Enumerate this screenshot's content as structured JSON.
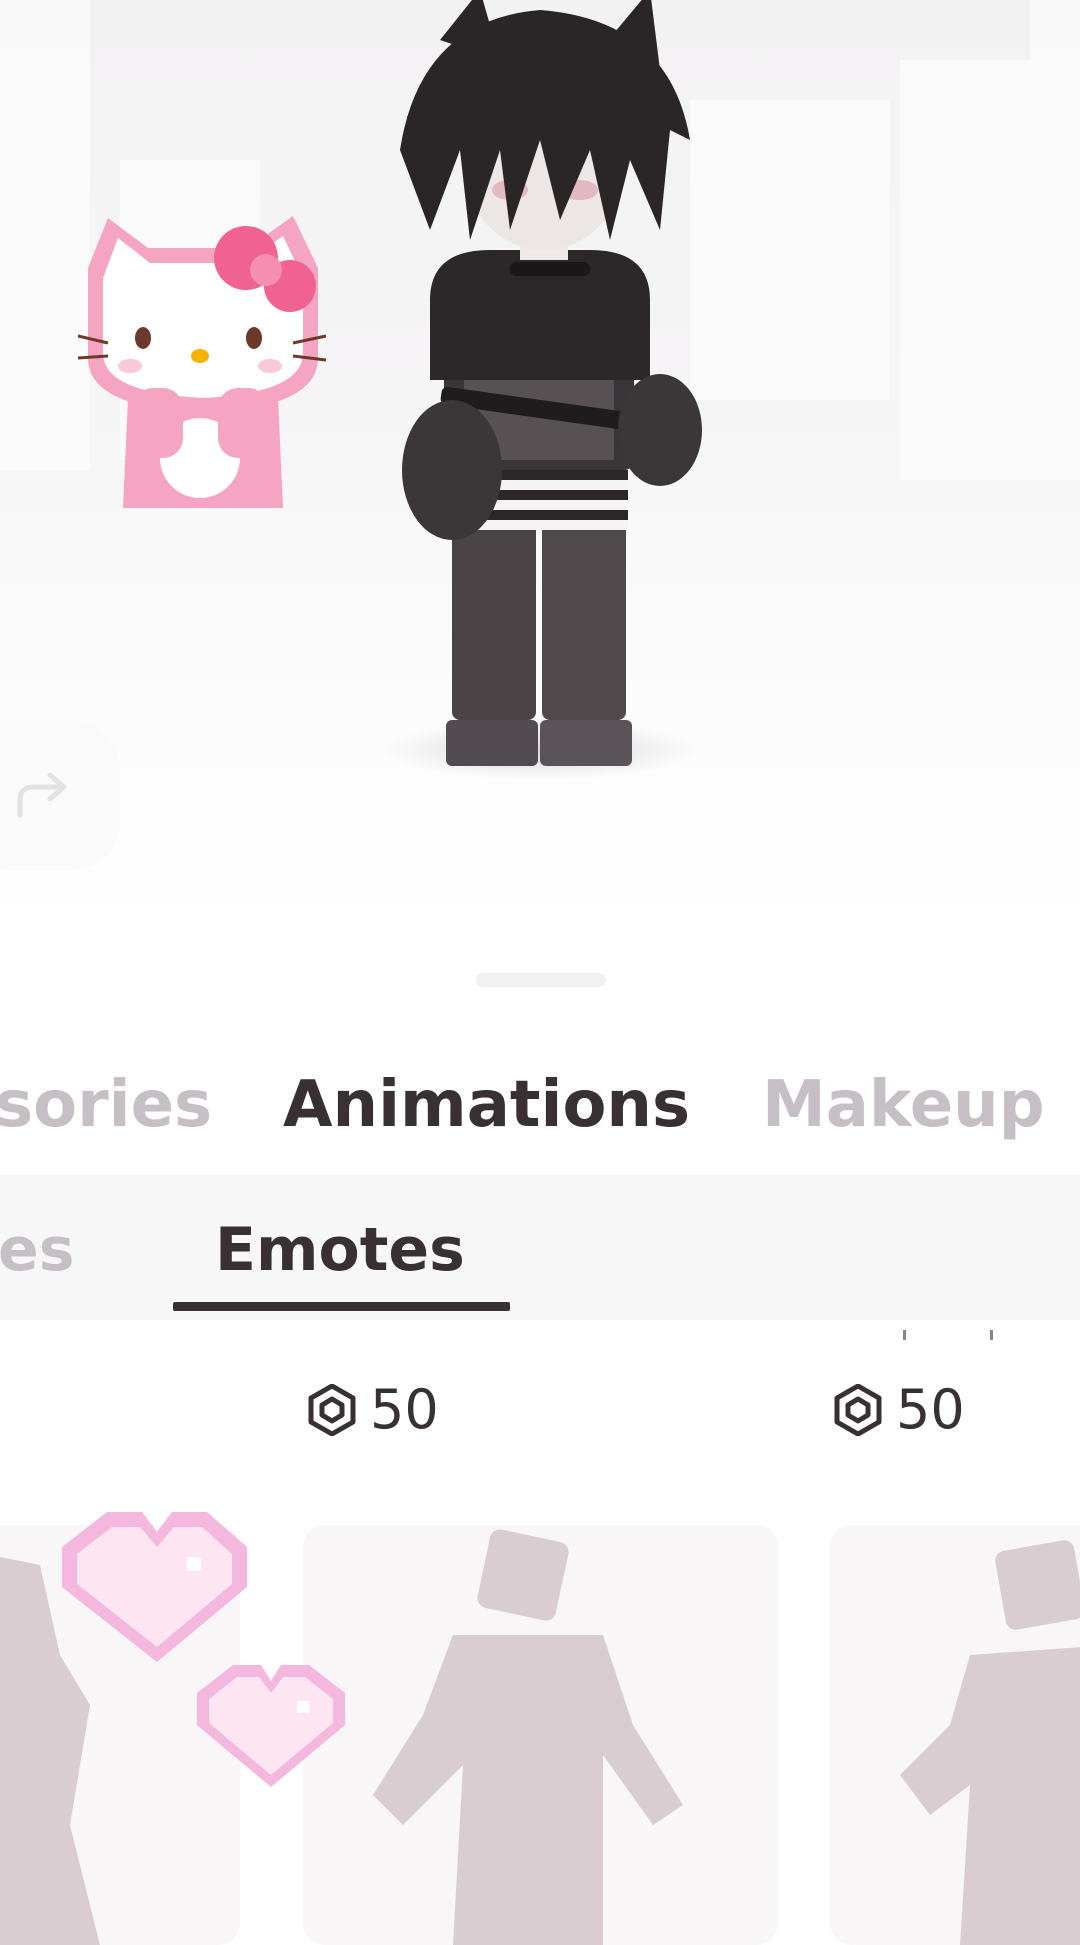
{
  "category_tabs": [
    {
      "label": "Accessories",
      "display": "sories",
      "active": false
    },
    {
      "label": "Animations",
      "display": "Animations",
      "active": true
    },
    {
      "label": "Makeup",
      "display": "Makeup",
      "active": false
    }
  ],
  "sub_tabs": [
    {
      "label": "es",
      "active": false
    },
    {
      "label": "Emotes",
      "active": true
    }
  ],
  "items": [
    {
      "price": "50",
      "currency_icon": "robux-icon"
    },
    {
      "price": "50",
      "currency_icon": "robux-icon"
    }
  ],
  "icons": {
    "redo": "redo-arrow-icon",
    "currency": "robux-icon"
  },
  "colors": {
    "active_text": "#393033",
    "inactive_text": "#c6bfc6",
    "silhouette": "#d9cdd1",
    "sticker_pink": "#f7a9c6"
  }
}
